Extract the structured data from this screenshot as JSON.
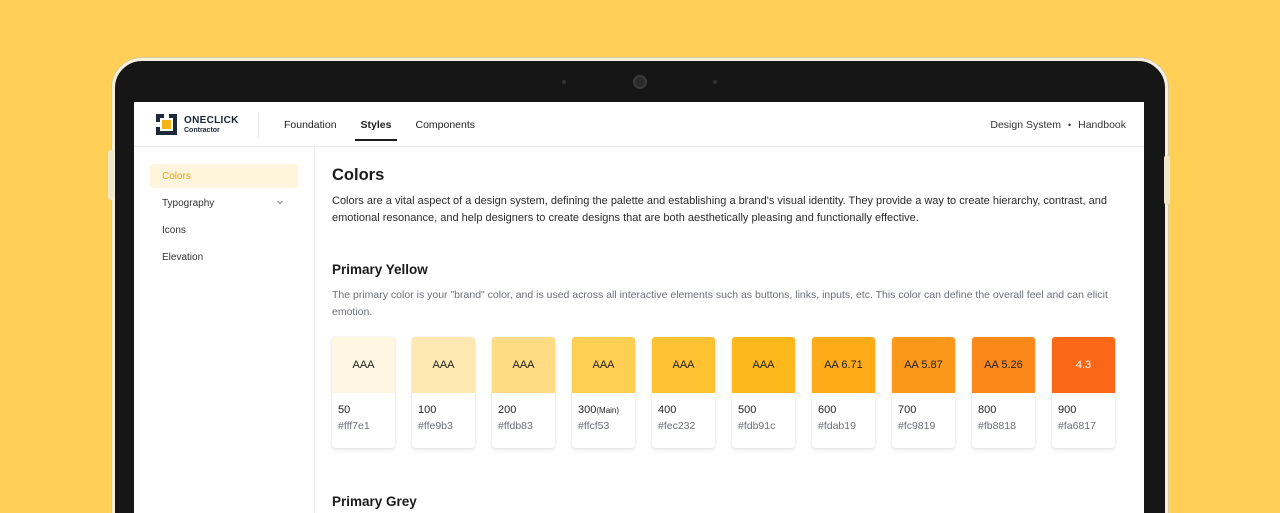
{
  "brand": {
    "line1": "ONECLICK",
    "line2": "Contractor"
  },
  "nav": [
    {
      "label": "Foundation",
      "active": false
    },
    {
      "label": "Styles",
      "active": true
    },
    {
      "label": "Components",
      "active": false
    }
  ],
  "header_right": {
    "left": "Design System",
    "separator": "•",
    "right": "Handbook"
  },
  "sidebar": [
    {
      "label": "Colors",
      "active": true
    },
    {
      "label": "Typography",
      "active": false,
      "icon": "chevron-down-icon"
    },
    {
      "label": "Icons",
      "active": false
    },
    {
      "label": "Elevation",
      "active": false
    }
  ],
  "main": {
    "title": "Colors",
    "intro": "Colors are a vital aspect of a design system, defining the palette and establishing a brand's visual identity. They provide a way to create hierarchy, contrast, and emotional resonance, and help designers to create designs that are both aesthetically pleasing and functionally effective.",
    "section1": {
      "title": "Primary Yellow",
      "description": "The primary color is your \"brand\" color, and is used across all interactive elements such as buttons, links, inputs, etc. This color can define the overall feel and can elicit emotion.",
      "swatches": [
        {
          "name": "50",
          "suffix": "",
          "hex": "#fff7e1",
          "color": "#fff7e1",
          "contrast": "AAA",
          "text_color": "#222222"
        },
        {
          "name": "100",
          "suffix": "",
          "hex": "#ffe9b3",
          "color": "#ffe9b3",
          "contrast": "AAA",
          "text_color": "#222222"
        },
        {
          "name": "200",
          "suffix": "",
          "hex": "#ffdb83",
          "color": "#ffdb83",
          "contrast": "AAA",
          "text_color": "#222222"
        },
        {
          "name": "300",
          "suffix": "(Main)",
          "hex": "#ffcf53",
          "color": "#ffcf53",
          "contrast": "AAA",
          "text_color": "#222222"
        },
        {
          "name": "400",
          "suffix": "",
          "hex": "#fec232",
          "color": "#fec232",
          "contrast": "AAA",
          "text_color": "#222222"
        },
        {
          "name": "500",
          "suffix": "",
          "hex": "#fdb91c",
          "color": "#fdb91c",
          "contrast": "AAA",
          "text_color": "#222222"
        },
        {
          "name": "600",
          "suffix": "",
          "hex": "#fdab19",
          "color": "#fdab19",
          "contrast": "AA 6.71",
          "text_color": "#222222"
        },
        {
          "name": "700",
          "suffix": "",
          "hex": "#fc9819",
          "color": "#fc9819",
          "contrast": "AA 5.87",
          "text_color": "#222222"
        },
        {
          "name": "800",
          "suffix": "",
          "hex": "#fb8818",
          "color": "#fb8818",
          "contrast": "AA 5.26",
          "text_color": "#222222"
        },
        {
          "name": "900",
          "suffix": "",
          "hex": "#fa6817",
          "color": "#fa6817",
          "contrast": "4.3",
          "text_color": "#ffffff"
        }
      ]
    },
    "section2": {
      "title": "Primary Grey"
    }
  },
  "colors": {
    "background": "#ffcf56",
    "accent": "#e8a316",
    "active_bg": "#fff5dc"
  }
}
